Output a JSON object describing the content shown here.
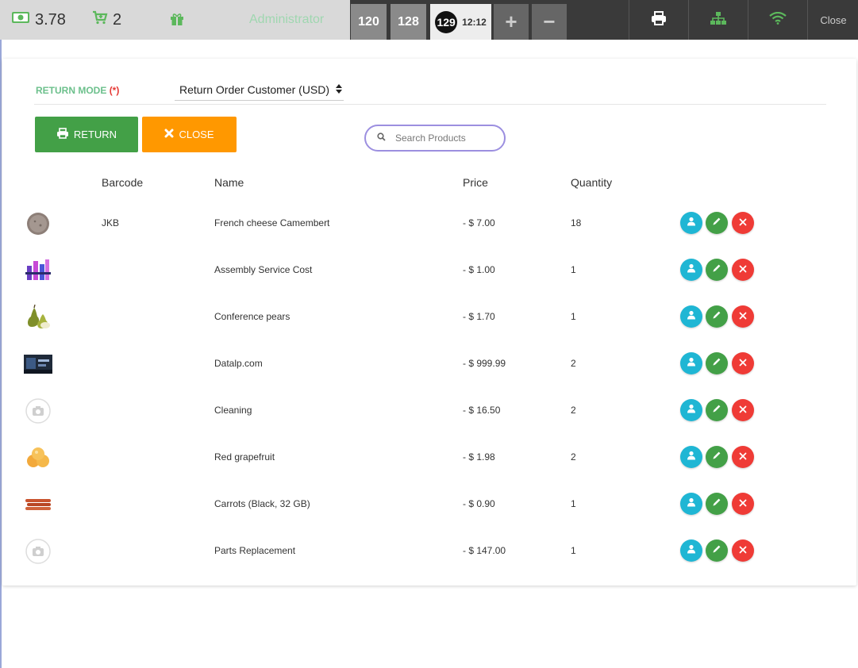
{
  "topbar": {
    "balance": "3.78",
    "cart_count": "2",
    "user": "Administrator",
    "orders": [
      {
        "label": "120"
      },
      {
        "label": "128"
      }
    ],
    "active_order": {
      "number": "129",
      "time": "12:12"
    },
    "add_label": "+",
    "remove_label": "−",
    "close_label": "Close",
    "icons": [
      "cash-icon",
      "cart-plus-icon",
      "gift-icon",
      "printer-icon",
      "network-icon",
      "wifi-icon"
    ],
    "colors": {
      "accent_green": "#5cb85c",
      "bar_dark": "#3a3a3a",
      "bar_light": "#d9d9d9"
    }
  },
  "form": {
    "mode_label": "RETURN MODE",
    "required_mark": "(*)",
    "mode_value": "Return Order Customer (USD)",
    "return_label": "RETURN",
    "close_label": "CLOSE",
    "search_placeholder": "Search Products"
  },
  "table": {
    "headers": {
      "barcode": "Barcode",
      "name": "Name",
      "price": "Price",
      "quantity": "Quantity"
    },
    "rows": [
      {
        "thumb": "cheese-icon",
        "barcode": "JKB",
        "name": "French cheese Camembert",
        "price": "- $ 7.00",
        "quantity": "18"
      },
      {
        "thumb": "assembly-icon",
        "barcode": "",
        "name": "Assembly Service Cost",
        "price": "- $ 1.00",
        "quantity": "1"
      },
      {
        "thumb": "pears-icon",
        "barcode": "",
        "name": "Conference pears",
        "price": "- $ 1.70",
        "quantity": "1"
      },
      {
        "thumb": "banner-icon",
        "barcode": "",
        "name": "Datalp.com",
        "price": "- $ 999.99",
        "quantity": "2"
      },
      {
        "thumb": "camera-placeholder-icon",
        "barcode": "",
        "name": "Cleaning",
        "price": "- $ 16.50",
        "quantity": "2"
      },
      {
        "thumb": "grapefruit-icon",
        "barcode": "",
        "name": "Red grapefruit",
        "price": "- $ 1.98",
        "quantity": "2"
      },
      {
        "thumb": "carrots-icon",
        "barcode": "",
        "name": "Carrots (Black, 32 GB)",
        "price": "- $ 0.90",
        "quantity": "1"
      },
      {
        "thumb": "camera-placeholder-icon",
        "barcode": "",
        "name": "Parts Replacement",
        "price": "- $ 147.00",
        "quantity": "1"
      }
    ],
    "action_colors": {
      "user": "#1fb6d4",
      "edit": "#43a047",
      "delete": "#ef3b36"
    }
  }
}
